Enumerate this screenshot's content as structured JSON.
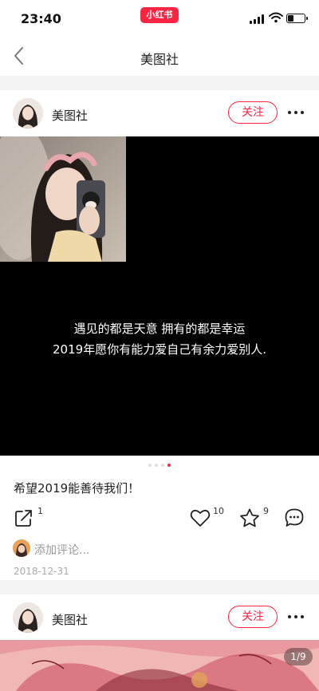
{
  "status_bar": {
    "time": "23:40",
    "app_badge": "小红书",
    "battery_level": 0.35
  },
  "nav": {
    "title": "美图社"
  },
  "posts": [
    {
      "author": "美图社",
      "follow_label": "关注",
      "image": {
        "caption_line1": "遇见的都是天意  拥有的都是幸运",
        "caption_line2": "2019年愿你有能力爱自己有余力爱别人."
      },
      "carousel": {
        "total": 4,
        "active": 4
      },
      "text": "希望2019能善待我们！",
      "actions": {
        "share_count": "1",
        "like_count": "10",
        "collect_count": "9"
      },
      "comment_placeholder": "添加评论...",
      "date": "2018-12-31"
    },
    {
      "author": "美图社",
      "follow_label": "关注",
      "page_indicator": "1/9"
    }
  ],
  "colors": {
    "brand": "#ff2442",
    "background": "#ffffff",
    "divider": "#f4f4f4",
    "muted_text": "#999999"
  },
  "icons": {
    "back": "chevron-left-icon",
    "more": "ellipsis-icon",
    "share": "share-icon",
    "like": "heart-icon",
    "collect": "star-icon",
    "comment": "comment-icon"
  }
}
